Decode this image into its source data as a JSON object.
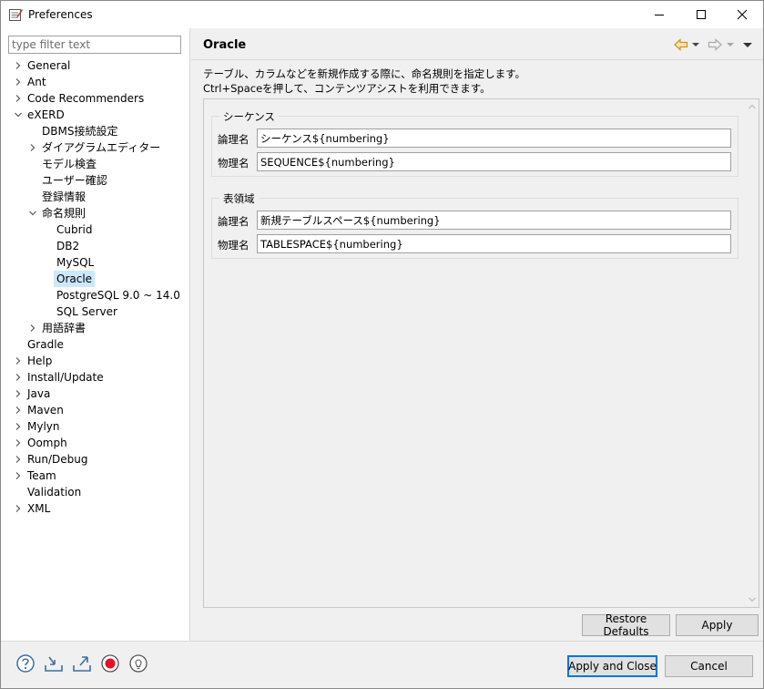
{
  "window": {
    "title": "Preferences"
  },
  "filter": {
    "placeholder": "type filter text"
  },
  "tree": [
    {
      "label": "General",
      "expand": "collapsed"
    },
    {
      "label": "Ant",
      "expand": "collapsed"
    },
    {
      "label": "Code Recommenders",
      "expand": "collapsed"
    },
    {
      "label": "eXERD",
      "expand": "expanded"
    },
    {
      "label": "DBMS接続設定",
      "expand": "none"
    },
    {
      "label": "ダイアグラムエディター",
      "expand": "collapsed"
    },
    {
      "label": "モデル検査",
      "expand": "none"
    },
    {
      "label": "ユーザー確認",
      "expand": "none"
    },
    {
      "label": "登録情報",
      "expand": "none"
    },
    {
      "label": "命名規則",
      "expand": "expanded"
    },
    {
      "label": "Cubrid",
      "expand": "none"
    },
    {
      "label": "DB2",
      "expand": "none"
    },
    {
      "label": "MySQL",
      "expand": "none"
    },
    {
      "label": "Oracle",
      "expand": "none",
      "selected": true
    },
    {
      "label": "PostgreSQL 9.0 ~ 14.0",
      "expand": "none"
    },
    {
      "label": "SQL Server",
      "expand": "none"
    },
    {
      "label": "用語辞書",
      "expand": "collapsed"
    },
    {
      "label": "Gradle",
      "expand": "none"
    },
    {
      "label": "Help",
      "expand": "collapsed"
    },
    {
      "label": "Install/Update",
      "expand": "collapsed"
    },
    {
      "label": "Java",
      "expand": "collapsed"
    },
    {
      "label": "Maven",
      "expand": "collapsed"
    },
    {
      "label": "Mylyn",
      "expand": "collapsed"
    },
    {
      "label": "Oomph",
      "expand": "collapsed"
    },
    {
      "label": "Run/Debug",
      "expand": "collapsed"
    },
    {
      "label": "Team",
      "expand": "collapsed"
    },
    {
      "label": "Validation",
      "expand": "none"
    },
    {
      "label": "XML",
      "expand": "collapsed"
    }
  ],
  "page": {
    "title": "Oracle",
    "description_line1": "テーブル、カラムなどを新規作成する際に、命名規則を指定します。",
    "description_line2": "Ctrl+Spaceを押して、コンテンツアシストを利用できます。",
    "groups": [
      {
        "label": "シーケンス",
        "fields": [
          {
            "label": "論理名",
            "value": "シーケンス${numbering}"
          },
          {
            "label": "物理名",
            "value": "SEQUENCE${numbering}"
          }
        ]
      },
      {
        "label": "表領域",
        "fields": [
          {
            "label": "論理名",
            "value": "新規テーブルスペース${numbering}"
          },
          {
            "label": "物理名",
            "value": "TABLESPACE${numbering}"
          }
        ]
      }
    ]
  },
  "buttons": {
    "restore_defaults": "Restore Defaults",
    "apply": "Apply",
    "apply_and_close": "Apply and Close",
    "cancel": "Cancel"
  },
  "colors": {
    "selection": "#cce8ff",
    "default_button_border": "#0078d7",
    "nav_arrow": "#e8a33a",
    "record_icon": "#e81123"
  }
}
